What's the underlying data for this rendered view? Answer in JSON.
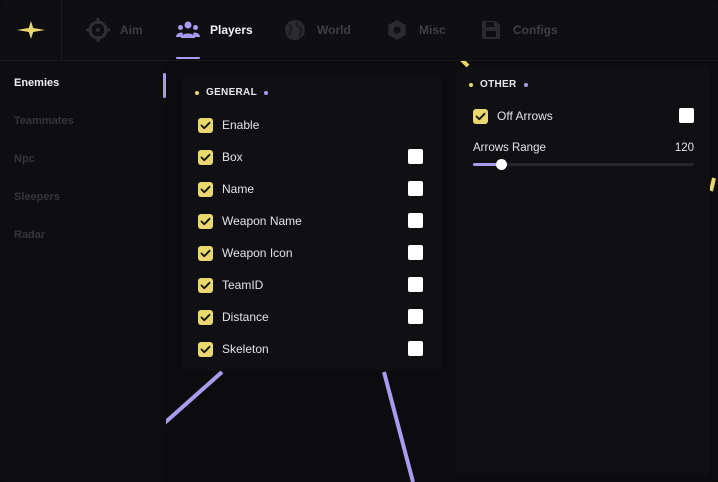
{
  "colors": {
    "accent_purple": "#a89cf0",
    "accent_yellow": "#ead86e",
    "background": "#0c0c0e",
    "panel": "#101013"
  },
  "logo": {
    "icon": "sparkle-icon"
  },
  "tabs": [
    {
      "label": "Aim",
      "icon": "crosshair-icon",
      "active": false
    },
    {
      "label": "Players",
      "icon": "users-icon",
      "active": true
    },
    {
      "label": "World",
      "icon": "globe-icon",
      "active": false
    },
    {
      "label": "Misc",
      "icon": "gear-icon",
      "active": false
    },
    {
      "label": "Configs",
      "icon": "save-icon",
      "active": false
    }
  ],
  "sidebar": {
    "items": [
      {
        "label": "Enemies",
        "active": true
      },
      {
        "label": "Teammates",
        "active": false
      },
      {
        "label": "Npc",
        "active": false
      },
      {
        "label": "Sleepers",
        "active": false
      },
      {
        "label": "Radar",
        "active": false
      }
    ]
  },
  "general": {
    "title": "GENERAL",
    "options": [
      {
        "label": "Enable",
        "checked": true,
        "has_color_box": false
      },
      {
        "label": "Box",
        "checked": true,
        "has_color_box": true
      },
      {
        "label": "Name",
        "checked": true,
        "has_color_box": true
      },
      {
        "label": "Weapon Name",
        "checked": true,
        "has_color_box": true
      },
      {
        "label": "Weapon Icon",
        "checked": true,
        "has_color_box": true
      },
      {
        "label": "TeamID",
        "checked": true,
        "has_color_box": true
      },
      {
        "label": "Distance",
        "checked": true,
        "has_color_box": true
      },
      {
        "label": "Skeleton",
        "checked": true,
        "has_color_box": true
      }
    ]
  },
  "other": {
    "title": "OTHER",
    "off_arrows": {
      "label": "Off Arrows",
      "checked": true
    },
    "arrows_range": {
      "label": "Arrows Range",
      "value": "120",
      "fraction": 0.125
    }
  }
}
